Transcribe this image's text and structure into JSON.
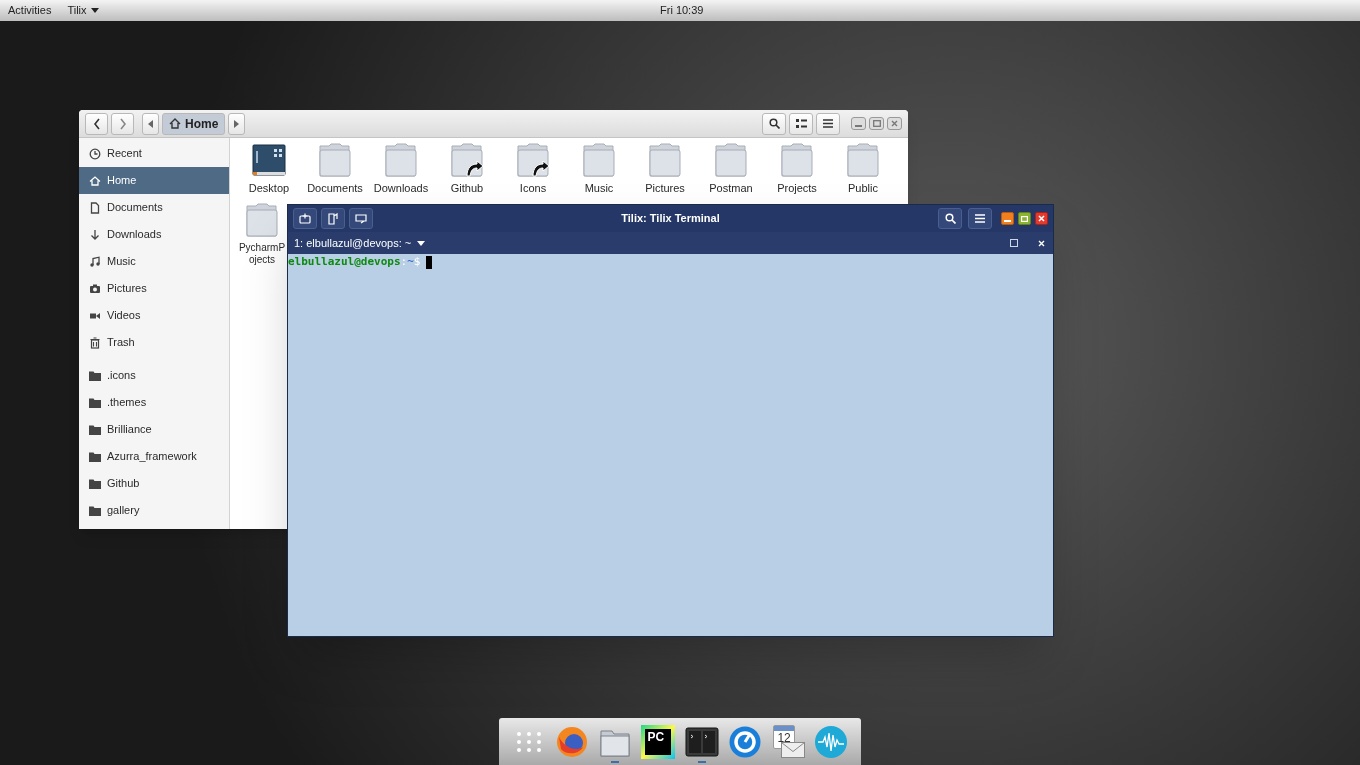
{
  "top_bar": {
    "activities": "Activities",
    "app_menu": "Tilix",
    "clock": "Fri 10:39"
  },
  "files_window": {
    "path_button": "Home",
    "sidebar": [
      {
        "label": "Recent",
        "kind": "recent",
        "selected": false
      },
      {
        "label": "Home",
        "kind": "home",
        "selected": true
      },
      {
        "label": "Documents",
        "kind": "document",
        "selected": false
      },
      {
        "label": "Downloads",
        "kind": "download",
        "selected": false
      },
      {
        "label": "Music",
        "kind": "music",
        "selected": false
      },
      {
        "label": "Pictures",
        "kind": "camera",
        "selected": false
      },
      {
        "label": "Videos",
        "kind": "video",
        "selected": false
      },
      {
        "label": "Trash",
        "kind": "trash",
        "selected": false
      }
    ],
    "bookmarks": [
      {
        "label": ".icons"
      },
      {
        "label": ".themes"
      },
      {
        "label": "Brilliance"
      },
      {
        "label": "Azurra_framework"
      },
      {
        "label": "Github"
      },
      {
        "label": "gallery"
      }
    ],
    "items": [
      {
        "label": "Desktop",
        "kind": "desktop"
      },
      {
        "label": "Documents",
        "kind": "folder"
      },
      {
        "label": "Downloads",
        "kind": "folder"
      },
      {
        "label": "Github",
        "kind": "link"
      },
      {
        "label": "Icons",
        "kind": "link"
      },
      {
        "label": "Music",
        "kind": "folder"
      },
      {
        "label": "Pictures",
        "kind": "folder"
      },
      {
        "label": "Postman",
        "kind": "folder"
      },
      {
        "label": "Projects",
        "kind": "folder"
      },
      {
        "label": "Public",
        "kind": "folder"
      },
      {
        "label": "PycharmP ojects",
        "kind": "partial_folder"
      }
    ]
  },
  "terminal_window": {
    "title": "Tilix: Tilix Terminal",
    "session": "1: elbullazul@devops: ~",
    "prompt_user": "elbullazul@devops",
    "prompt_sep": ":",
    "prompt_path": "~",
    "prompt_end": "$"
  },
  "dock": [
    {
      "kind": "grid",
      "running": false
    },
    {
      "kind": "browser",
      "running": false
    },
    {
      "kind": "files",
      "running": true
    },
    {
      "kind": "ide",
      "running": false,
      "text": "PC"
    },
    {
      "kind": "terminal",
      "running": true
    },
    {
      "kind": "circle",
      "running": false
    },
    {
      "kind": "calendar",
      "running": false,
      "text": "12"
    },
    {
      "kind": "wave",
      "running": false
    }
  ]
}
